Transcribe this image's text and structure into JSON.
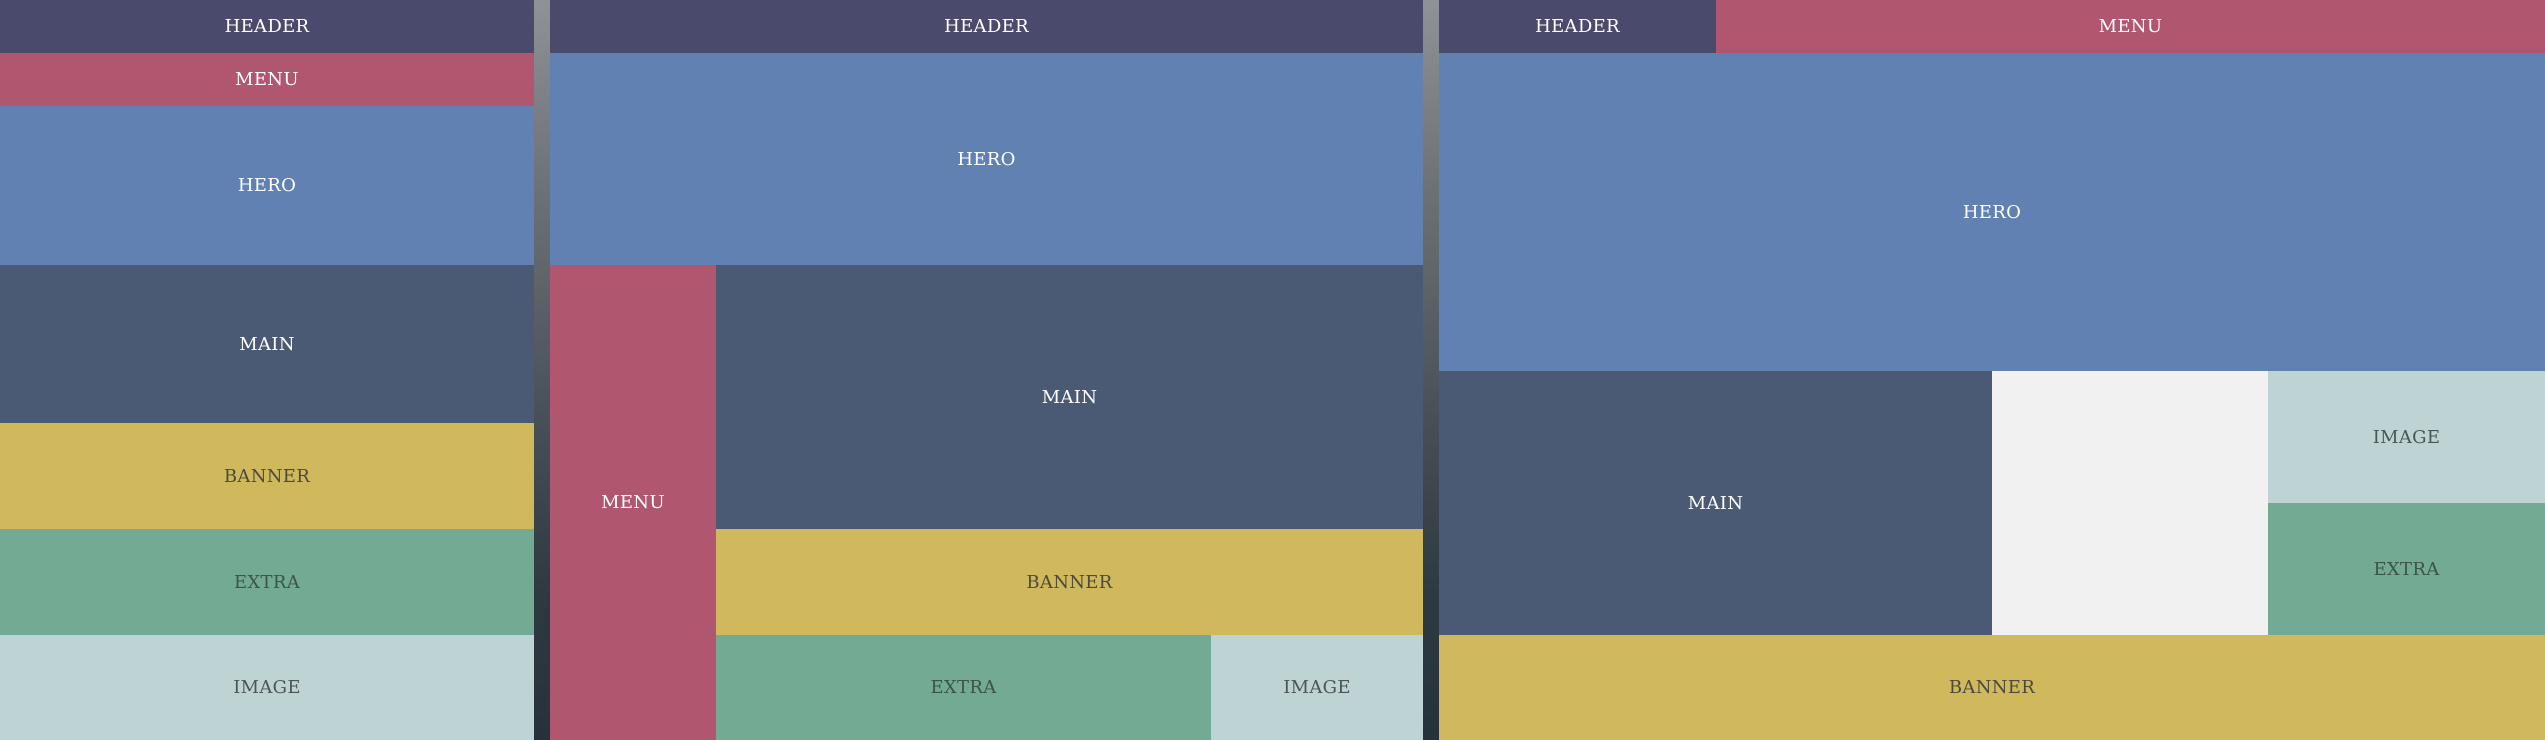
{
  "colors": {
    "header": "#4a4a6d",
    "menu": "#b0566f",
    "hero": "#6181b2",
    "main": "#4b5a74",
    "banner": "#d0b95d",
    "extra": "#72aa94",
    "image": "#bed3d4",
    "empty": "#f1f1f1",
    "backdrop": "#4a5258"
  },
  "mobile": {
    "header": "HEADER",
    "menu": "MENU",
    "hero": "HERO",
    "main": "MAIN",
    "banner": "BANNER",
    "extra": "EXTRA",
    "image": "IMAGE"
  },
  "tablet": {
    "header": "HEADER",
    "hero": "HERO",
    "menu": "MENU",
    "main": "MAIN",
    "banner": "BANNER",
    "extra": "EXTRA",
    "image": "IMAGE"
  },
  "desktop": {
    "header": "HEADER",
    "menu": "MENU",
    "hero": "HERO",
    "main": "MAIN",
    "image": "IMAGE",
    "extra": "EXTRA",
    "banner": "BANNER"
  }
}
